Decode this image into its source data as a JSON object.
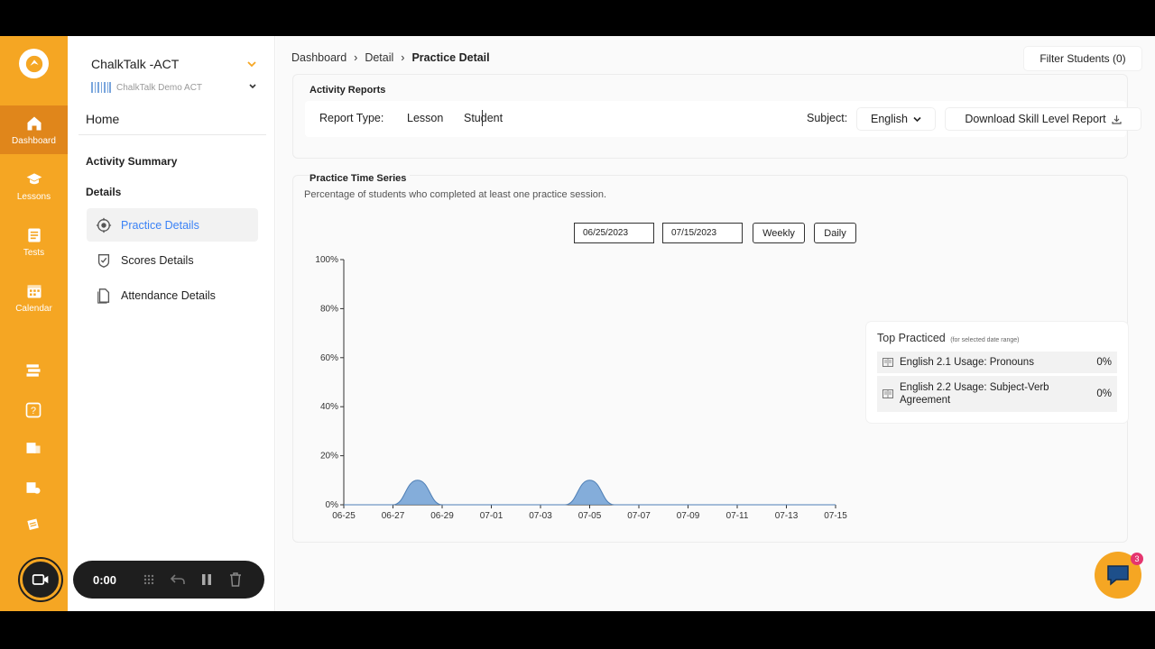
{
  "sidebar_rail": {
    "items": [
      {
        "label": "Dashboard",
        "icon": "home-icon",
        "active": true
      },
      {
        "label": "Lessons",
        "icon": "graduation-cap-icon"
      },
      {
        "label": "Tests",
        "icon": "clipboard-icon"
      },
      {
        "label": "Calendar",
        "icon": "calendar-icon"
      }
    ],
    "extra_icons": [
      "book-stack-icon",
      "help-icon",
      "report-icon",
      "report-settings-icon",
      "cards-icon"
    ]
  },
  "recorder": {
    "time": "0:00"
  },
  "org": {
    "name": "ChalkTalk -ACT",
    "sub": "ChalkTalk Demo ACT"
  },
  "nav": {
    "home": "Home",
    "activity_summary": "Activity Summary",
    "details": "Details",
    "items": [
      {
        "label": "Practice Details",
        "icon": "practice-icon",
        "active": true
      },
      {
        "label": "Scores Details",
        "icon": "scores-icon"
      },
      {
        "label": "Attendance Details",
        "icon": "attendance-icon"
      }
    ]
  },
  "breadcrumb": [
    "Dashboard",
    "Detail",
    "Practice Detail"
  ],
  "breadcrumb_sep": "›",
  "filter_button": "Filter Students (0)",
  "activity_reports": {
    "title": "Activity Reports",
    "report_type_label": "Report Type:",
    "options": [
      "Lesson",
      "Student"
    ],
    "subject_label": "Subject:",
    "subject_value": "English",
    "download_label": "Download Skill Level Report"
  },
  "practice": {
    "title": "Practice Time Series",
    "description": "Percentage of students who completed at least one practice session.",
    "start_date": "06/25/2023",
    "end_date": "07/15/2023",
    "weekly": "Weekly",
    "daily": "Daily"
  },
  "chart_data": {
    "type": "area",
    "x": [
      "06-25",
      "06-26",
      "06-27",
      "06-28",
      "06-29",
      "06-30",
      "07-01",
      "07-02",
      "07-03",
      "07-04",
      "07-05",
      "07-06",
      "07-07",
      "07-08",
      "07-09",
      "07-10",
      "07-11",
      "07-12",
      "07-13",
      "07-14",
      "07-15"
    ],
    "y": [
      0,
      0,
      0,
      10,
      0,
      0,
      0,
      0,
      0,
      0,
      10,
      0,
      0,
      0,
      0,
      0,
      0,
      0,
      0,
      0,
      0
    ],
    "xticks": [
      "06-25",
      "06-27",
      "06-29",
      "07-01",
      "07-03",
      "07-05",
      "07-07",
      "07-09",
      "07-11",
      "07-13",
      "07-15"
    ],
    "yticks": [
      "0%",
      "20%",
      "40%",
      "60%",
      "80%",
      "100%"
    ],
    "ylim": [
      0,
      100
    ],
    "color": "#6e9fd3"
  },
  "top_practiced": {
    "title": "Top Practiced",
    "subtitle": "(for selected date range)",
    "rows": [
      {
        "name": "English 2.1 Usage: Pronouns",
        "pct": "0%"
      },
      {
        "name": "English 2.2 Usage: Subject-Verb Agreement",
        "pct": "0%"
      }
    ]
  },
  "chat": {
    "badge": "3"
  },
  "colors": {
    "accent": "#f5a623",
    "active_link": "#3b82f6"
  }
}
